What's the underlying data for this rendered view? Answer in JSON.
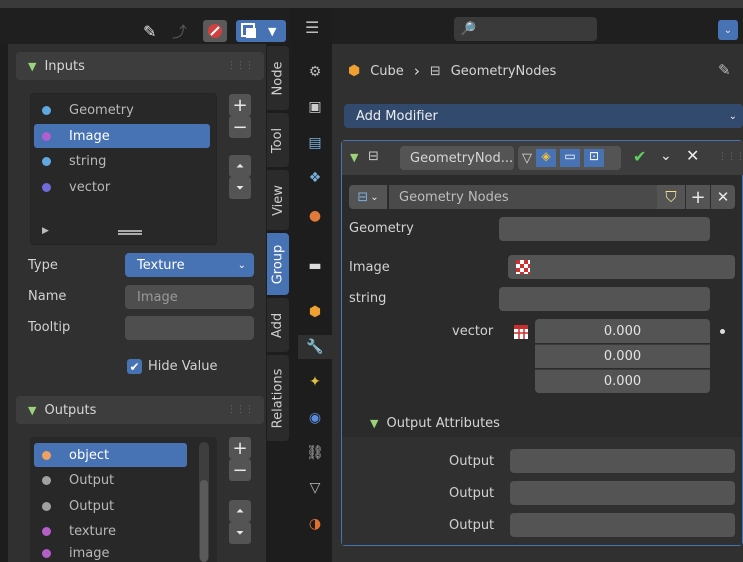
{
  "left_panel": {
    "inputs_header": "Inputs",
    "inputs": [
      {
        "label": "Geometry",
        "color": "#5fa8e0"
      },
      {
        "label": "Image",
        "color": "#b05ed0"
      },
      {
        "label": "string",
        "color": "#62a8e0"
      },
      {
        "label": "vector",
        "color": "#6f6bd8"
      }
    ],
    "type_label": "Type",
    "type_value": "Texture",
    "name_label": "Name",
    "name_value": "Image",
    "tooltip_label": "Tooltip",
    "tooltip_value": "",
    "hide_value_label": "Hide Value",
    "outputs_header": "Outputs",
    "outputs": [
      {
        "label": "object",
        "color": "#f0a060"
      },
      {
        "label": "Output",
        "color": "#a0a0a0"
      },
      {
        "label": "Output",
        "color": "#a0a0a0"
      },
      {
        "label": "texture",
        "color": "#b45ec8"
      },
      {
        "label": "image",
        "color": "#b45ec8"
      }
    ]
  },
  "side_tabs": [
    "Node",
    "Tool",
    "View",
    "Group",
    "Add",
    "Relations"
  ],
  "properties": {
    "search_placeholder": "",
    "breadcrumb_object": "Cube",
    "breadcrumb_modifier": "GeometryNodes",
    "add_modifier_label": "Add Modifier",
    "modifier_name": "GeometryNod...",
    "node_group_name": "Geometry Nodes",
    "geometry_label": "Geometry",
    "image_label": "Image",
    "string_label": "string",
    "vector_label": "vector",
    "vector_values": [
      "0.000",
      "0.000",
      "0.000"
    ],
    "output_attributes_label": "Output Attributes",
    "output_labels": [
      "Output",
      "Output",
      "Output"
    ]
  },
  "colors": {
    "accent_blue": "#4772b3",
    "panel_bg": "#303030",
    "field_bg": "#545454"
  }
}
